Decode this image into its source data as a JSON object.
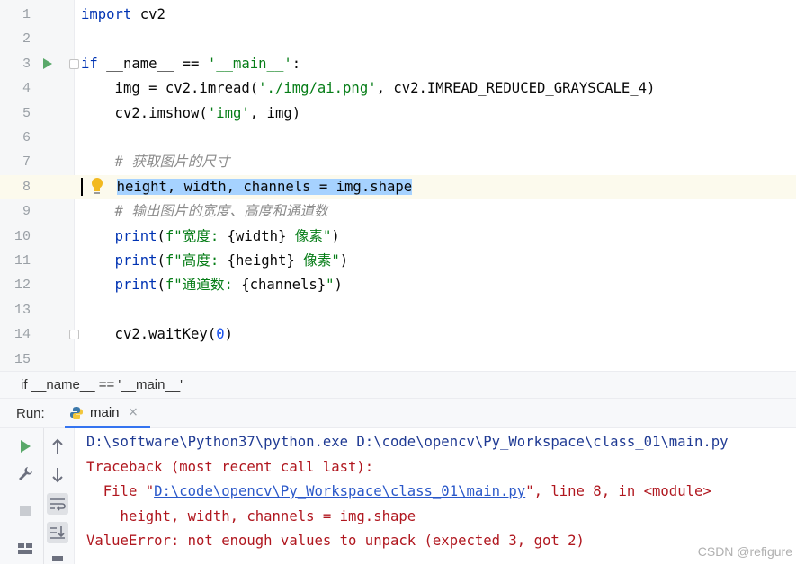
{
  "editor": {
    "lines": [
      {
        "num": "1"
      },
      {
        "num": "2"
      },
      {
        "num": "3"
      },
      {
        "num": "4"
      },
      {
        "num": "5"
      },
      {
        "num": "6"
      },
      {
        "num": "7"
      },
      {
        "num": "8"
      },
      {
        "num": "9"
      },
      {
        "num": "10"
      },
      {
        "num": "11"
      },
      {
        "num": "12"
      },
      {
        "num": "13"
      },
      {
        "num": "14"
      },
      {
        "num": "15"
      }
    ],
    "code": {
      "l1_kw": "import",
      "l1_rest": " cv2",
      "l3_kw": "if",
      "l3_mid": " __name__ == ",
      "l3_str": "'__main__'",
      "l3_end": ":",
      "l4_a": "    img = cv2.imread(",
      "l4_str": "'./img/ai.png'",
      "l4_b": ", cv2.IMREAD_REDUCED_GRAYSCALE_4)",
      "l5_a": "    cv2.imshow(",
      "l5_str": "'img'",
      "l5_b": ", img)",
      "l7_cmt": "    # 获取图片的尺寸",
      "l8_indent": "    ",
      "l8_sel": "height, width, channels = img.shape",
      "l9_cmt": "    # 输出图片的宽度、高度和通道数",
      "l10_ind": "    ",
      "l10_fn": "print",
      "l10_a": "(",
      "l10_str1": "f\"宽度: ",
      "l10_var": "{width}",
      "l10_str2": " 像素\"",
      "l10_end": ")",
      "l11_ind": "    ",
      "l11_fn": "print",
      "l11_a": "(",
      "l11_str1": "f\"高度: ",
      "l11_var": "{height}",
      "l11_str2": " 像素\"",
      "l11_end": ")",
      "l12_ind": "    ",
      "l12_fn": "print",
      "l12_a": "(",
      "l12_str1": "f\"通道数: ",
      "l12_var": "{channels}",
      "l12_str2": "\"",
      "l12_end": ")",
      "l14_a": "    cv2.waitKey(",
      "l14_num": "0",
      "l14_b": ")"
    }
  },
  "breadcrumb": {
    "text": "if __name__ == '__main__'"
  },
  "run": {
    "label": "Run:",
    "tab_label": "main",
    "tab_close": "×"
  },
  "console": {
    "cmd": "D:\\software\\Python37\\python.exe D:\\code\\opencv\\Py_Workspace\\class_01\\main.py",
    "traceback": "Traceback (most recent call last):",
    "file_prefix": "  File \"",
    "file_link": "D:\\code\\opencv\\Py_Workspace\\class_01\\main.py",
    "file_suffix": "\", line 8, in <module>",
    "code_line": "    height, width, channels = img.shape",
    "error": "ValueError: not enough values to unpack (expected 3, got 2)"
  },
  "watermark": "CSDN @refigure",
  "icons": {
    "run_gutter": "run-arrow-icon",
    "bulb": "lightbulb-icon",
    "python": "python-icon"
  },
  "colors": {
    "keyword": "#0033b3",
    "string": "#067d17",
    "comment": "#8c8c8c",
    "selection": "#a6d2ff",
    "error": "#b0171f",
    "accent": "#3574f0"
  }
}
